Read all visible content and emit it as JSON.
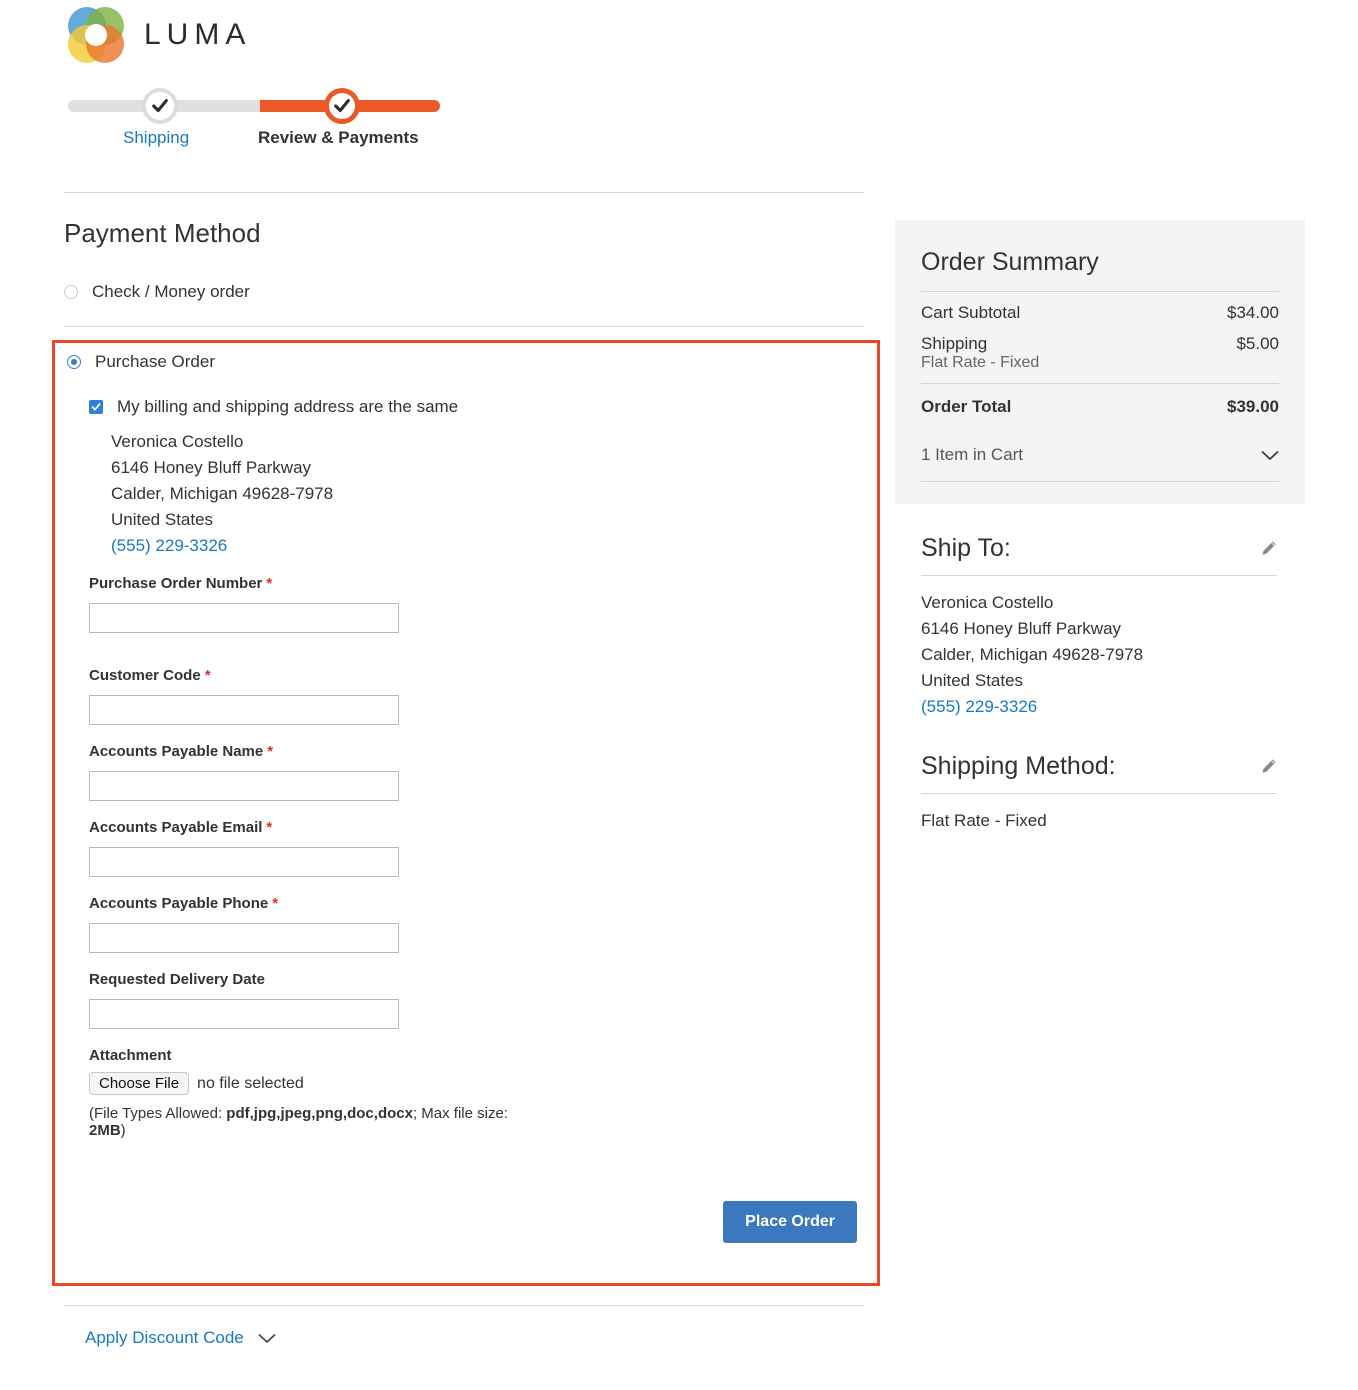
{
  "brand": {
    "name": "LUMA",
    "logo_icon": "luma-rings-logo"
  },
  "progress": {
    "steps": [
      {
        "label": "Shipping",
        "state": "complete",
        "icon": "check-icon"
      },
      {
        "label": "Review & Payments",
        "state": "active",
        "icon": "check-icon"
      }
    ]
  },
  "payment": {
    "heading": "Payment Method",
    "methods": [
      {
        "label": "Check / Money order",
        "selected": false
      },
      {
        "label": "Purchase Order",
        "selected": true
      }
    ],
    "billing_same_label": "My billing and shipping address are the same",
    "billing_same_checked": true,
    "billing_address": {
      "name": "Veronica Costello",
      "street": "6146 Honey Bluff Parkway",
      "city_state_zip": "Calder, Michigan 49628-7978",
      "country": "United States",
      "phone": "(555) 229-3326"
    },
    "fields": [
      {
        "label": "Purchase Order Number",
        "required": true,
        "value": "",
        "placeholder": ""
      },
      {
        "label": "Customer Code",
        "required": true,
        "value": "",
        "placeholder": ""
      },
      {
        "label": "Accounts Payable Name",
        "required": true,
        "value": "",
        "placeholder": ""
      },
      {
        "label": "Accounts Payable Email",
        "required": true,
        "value": "",
        "placeholder": ""
      },
      {
        "label": "Accounts Payable Phone",
        "required": true,
        "value": "",
        "placeholder": ""
      },
      {
        "label": "Requested Delivery Date",
        "required": false,
        "value": "",
        "placeholder": ""
      }
    ],
    "attachment": {
      "label": "Attachment",
      "button_label": "Choose File",
      "status": "no file selected",
      "note_prefix": "(File Types Allowed: ",
      "note_types": "pdf,jpg,jpeg,png,doc,docx",
      "note_middle": "; Max file size: ",
      "note_size": "2MB",
      "note_suffix": ")"
    },
    "place_order_label": "Place Order",
    "required_marker": "*"
  },
  "discount": {
    "label": "Apply Discount Code",
    "icon": "chevron-down-icon"
  },
  "summary": {
    "title": "Order Summary",
    "rows": [
      {
        "label": "Cart Subtotal",
        "value": "$34.00",
        "sub": ""
      },
      {
        "label": "Shipping",
        "value": "$5.00",
        "sub": "Flat Rate - Fixed"
      }
    ],
    "total_label": "Order Total",
    "total_value": "$39.00",
    "cart_label": "1 Item in Cart",
    "cart_icon": "chevron-down-icon"
  },
  "ship_to": {
    "title": "Ship To:",
    "edit_icon": "pencil-icon",
    "name": "Veronica Costello",
    "street": "6146 Honey Bluff Parkway",
    "city_state_zip": "Calder, Michigan 49628-7978",
    "country": "United States",
    "phone": "(555) 229-3326"
  },
  "shipping_method": {
    "title": "Shipping Method:",
    "edit_icon": "pencil-icon",
    "value": "Flat Rate - Fixed"
  },
  "colors": {
    "accent_orange": "#eb5a26",
    "link_blue": "#1979c3",
    "button_blue": "#3c78be",
    "highlight_red": "#e8472a",
    "required_red": "#e02b27",
    "panel_gray": "#f4f4f4"
  }
}
